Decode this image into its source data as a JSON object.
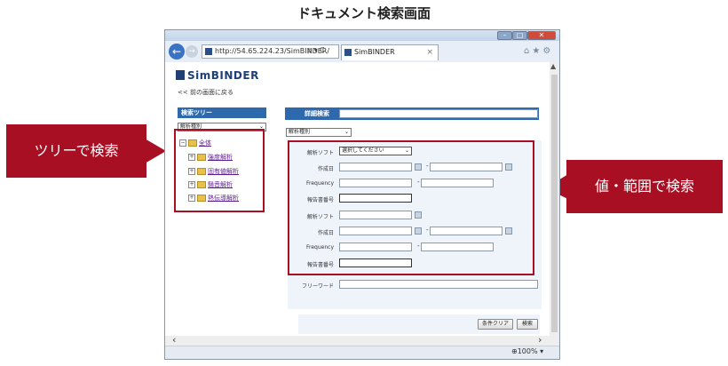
{
  "page_title": "ドキュメント検索画面",
  "browser": {
    "address": "http://54.65.224.23/SimBINDER/",
    "address_tools": "ρ ▾ C",
    "tab_title": "SimBINDER",
    "tab_close": "×",
    "zoom": "100%",
    "back_glyph": "←",
    "forward_glyph": "→"
  },
  "app": {
    "logo_text": "SimBINDER",
    "back_link": "<< 前の画面に戻る"
  },
  "tree": {
    "header": "検索ツリー",
    "select_value": "解析種別",
    "root_label": "全体",
    "items": [
      {
        "label": "強度解析"
      },
      {
        "label": "固有値解析"
      },
      {
        "label": "騒音解析"
      },
      {
        "label": "熱伝導解析"
      }
    ]
  },
  "detail": {
    "header": "詳細検索",
    "type_select_value": "解析種別",
    "rows1": {
      "software_label": "解析ソフト",
      "software_select": "選択してください",
      "date_label": "作成日",
      "freq_label": "Frequency",
      "report_label": "報告書番号"
    },
    "rows2": {
      "software_label": "解析ソフト",
      "date_label": "作成日",
      "freq_label": "Frequency",
      "report_label": "報告書番号"
    },
    "range_sep": "-",
    "freeword_label": "フリーワード",
    "clear_button": "条件クリア",
    "search_button": "検索"
  },
  "callouts": {
    "tree_search": "ツリーで検索",
    "value_search": "値・範囲で検索"
  },
  "colors": {
    "callout_red": "#a90f22",
    "panel_blue": "#2f69ad",
    "link_purple": "#5b1b8e"
  }
}
